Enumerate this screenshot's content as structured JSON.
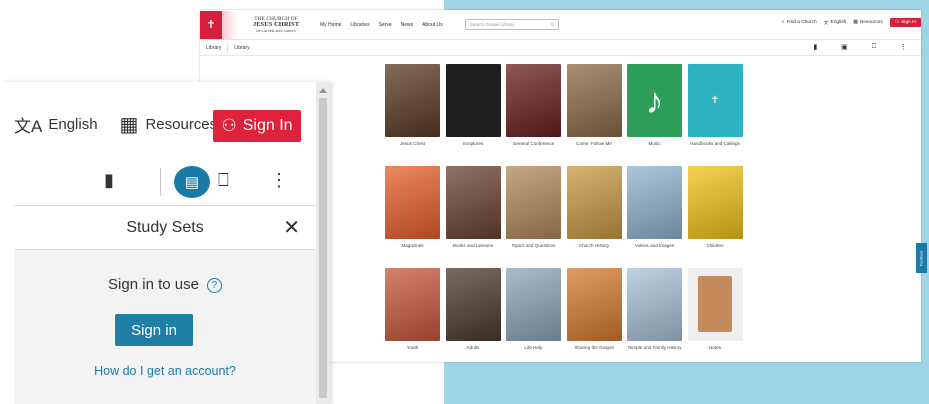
{
  "colors": {
    "brand_red": "#d61f3c",
    "accent_blue": "#1a7aa8",
    "page_bg": "#9fd6e6"
  },
  "header": {
    "logo_line1": "THE CHURCH OF",
    "logo_line2": "JESUS CHRIST",
    "logo_line3": "OF LATTER-DAY SAINTS",
    "nav": [
      "My Home",
      "Libraries",
      "Serve",
      "News",
      "About Us"
    ],
    "search_placeholder": "Search Gospel Library",
    "find_church": "Find a Church",
    "language": "English",
    "resources": "Resources",
    "sign_in": "Sign In"
  },
  "breadcrumb": [
    "Library",
    "Library"
  ],
  "library": [
    {
      "label": "Jesus Christ",
      "icon": "jesus-portrait",
      "color": "#5b3a24"
    },
    {
      "label": "Scriptures",
      "icon": "scripture-book",
      "color": "#1e1e1e"
    },
    {
      "label": "General Conference",
      "icon": "conference-speaker",
      "color": "#6a1f1f"
    },
    {
      "label": "Come, Follow Me",
      "icon": "come-follow-me",
      "color": "#8c6a48"
    },
    {
      "label": "Music",
      "icon": "music-note",
      "color": "#2e9e5b"
    },
    {
      "label": "Handbooks and Callings",
      "icon": "handbook",
      "color": "#2fb3c2"
    },
    {
      "label": "Magazines",
      "icon": "magazines",
      "color": "#e6612a"
    },
    {
      "label": "Books and Lessons",
      "icon": "books-lessons",
      "color": "#6a4331"
    },
    {
      "label": "Topics and Questions",
      "icon": "topics-questions",
      "color": "#b08a5a"
    },
    {
      "label": "Church History",
      "icon": "church-history",
      "color": "#c89a44"
    },
    {
      "label": "Videos and Images",
      "icon": "videos-images",
      "color": "#8fb4d0"
    },
    {
      "label": "Children",
      "icon": "children",
      "color": "#f2c21b"
    },
    {
      "label": "Youth",
      "icon": "youth",
      "color": "#c8583a"
    },
    {
      "label": "Adults",
      "icon": "adults",
      "color": "#4a3a30"
    },
    {
      "label": "Life Help",
      "icon": "life-help",
      "color": "#8aa7b8"
    },
    {
      "label": "Sharing the Gospel",
      "icon": "sharing-gospel",
      "color": "#d77b2f"
    },
    {
      "label": "Temple and Family History",
      "icon": "temple-family",
      "color": "#a9c2d9"
    },
    {
      "label": "Notes",
      "icon": "notes",
      "color": "#eeeeee"
    }
  ],
  "feedback": "Feedback",
  "zoom": {
    "language": "English",
    "resources": "Resources",
    "sign_in": "Sign In",
    "panel_title": "Study Sets",
    "sign_in_to_use": "Sign in to use",
    "sign_in_button": "Sign in",
    "account_link": "How do I get an account?"
  }
}
